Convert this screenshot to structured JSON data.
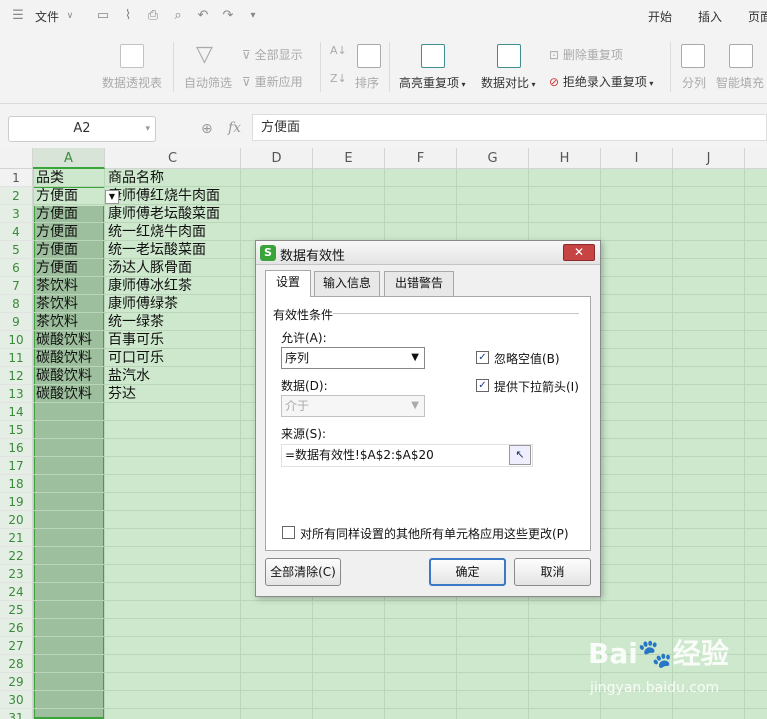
{
  "menu": {
    "file_label": "文件",
    "tabs": [
      "开始",
      "插入",
      "页面"
    ]
  },
  "ribbon": {
    "pivot_table": "数据透视表",
    "auto_filter": "自动筛选",
    "show_all": "全部显示",
    "reapply": "重新应用",
    "sort": "排序",
    "highlight_dup": "高亮重复项",
    "data_compare": "数据对比",
    "remove_dup": "删除重复项",
    "reject_dup": "拒绝录入重复项",
    "split_column": "分列",
    "smart_fill": "智能填充"
  },
  "formula_bar": {
    "name_box": "A2",
    "fx_label": "fx",
    "content": "方便面"
  },
  "sheet": {
    "columns": [
      "A",
      "C",
      "D",
      "E",
      "F",
      "G",
      "H",
      "I",
      "J"
    ],
    "row_numbers": [
      "1",
      "2",
      "3",
      "4",
      "5",
      "6",
      "7",
      "8",
      "9",
      "10",
      "11",
      "12",
      "13",
      "14",
      "15",
      "16",
      "17",
      "18",
      "19",
      "20",
      "21",
      "22",
      "23",
      "24",
      "25",
      "26",
      "27",
      "28",
      "29",
      "30",
      "31"
    ],
    "rows": [
      [
        "品类",
        "商品名称"
      ],
      [
        "方便面",
        "康师傅红烧牛肉面"
      ],
      [
        "方便面",
        "康师傅老坛酸菜面"
      ],
      [
        "方便面",
        "统一红烧牛肉面"
      ],
      [
        "方便面",
        "统一老坛酸菜面"
      ],
      [
        "方便面",
        "汤达人豚骨面"
      ],
      [
        "茶饮料",
        "康师傅冰红茶"
      ],
      [
        "茶饮料",
        "康师傅绿茶"
      ],
      [
        "茶饮料",
        "统一绿茶"
      ],
      [
        "碳酸饮料",
        "百事可乐"
      ],
      [
        "碳酸饮料",
        "可口可乐"
      ],
      [
        "碳酸饮料",
        "盐汽水"
      ],
      [
        "碳酸饮料",
        "芬达"
      ]
    ]
  },
  "dialog": {
    "title": "数据有效性",
    "tabs": [
      "设置",
      "输入信息",
      "出错警告"
    ],
    "criteria_group": "有效性条件",
    "allow_label": "允许(A):",
    "allow_value": "序列",
    "data_label": "数据(D):",
    "data_value": "介于",
    "ignore_blank": "忽略空值(B)",
    "ignore_blank_checked": true,
    "dropdown_arrow": "提供下拉箭头(I)",
    "dropdown_arrow_checked": true,
    "source_label": "来源(S):",
    "source_value": "=数据有效性!$A$2:$A$20",
    "apply_all": "对所有同样设置的其他所有单元格应用这些更改(P)",
    "apply_all_checked": false,
    "clear_all": "全部清除(C)",
    "ok": "确定",
    "cancel": "取消"
  },
  "watermark": {
    "logo": "Bai🐾经验",
    "sub": "jingyan.baidu.com"
  }
}
